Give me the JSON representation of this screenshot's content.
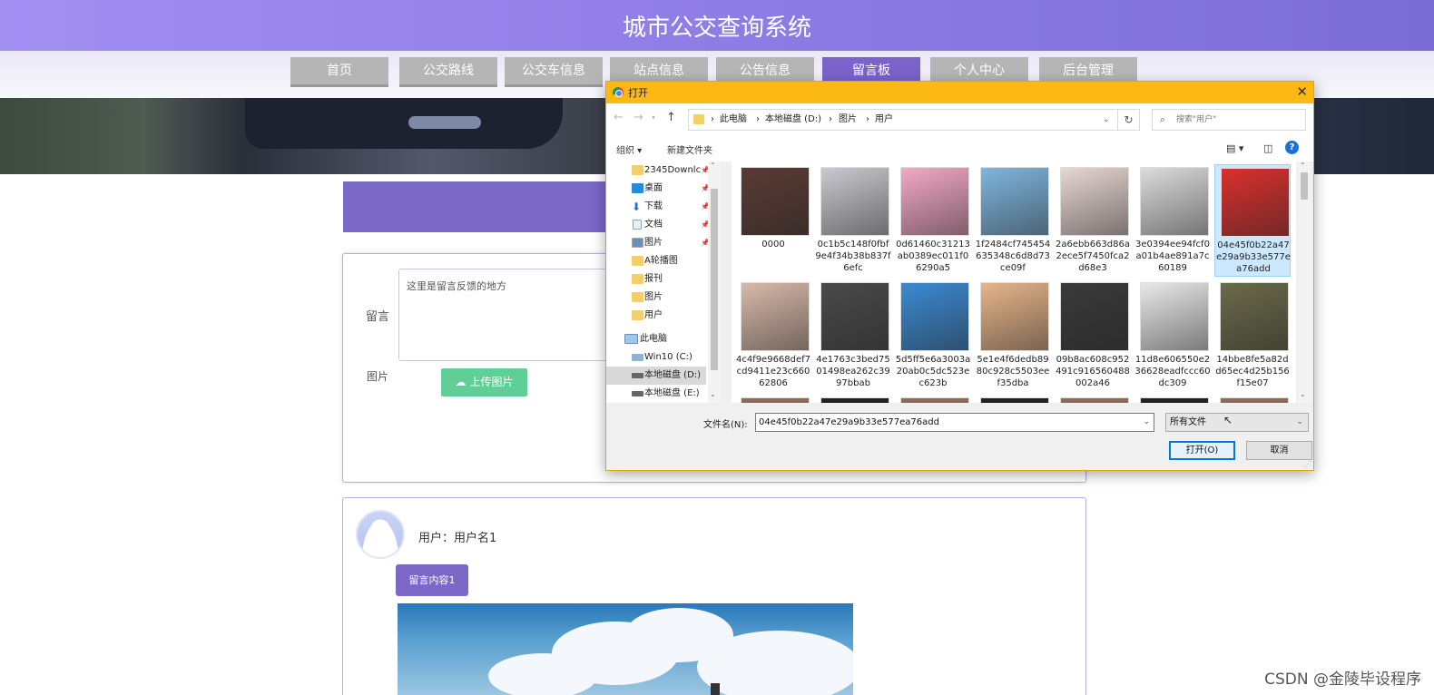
{
  "site": {
    "title": "城市公交查询系统",
    "nav": [
      "首页",
      "公交路线",
      "公交车信息",
      "站点信息",
      "公告信息",
      "留言板",
      "个人中心",
      "后台管理"
    ],
    "active_nav": "留言板"
  },
  "form": {
    "message_label": "留言",
    "message_placeholder": "这里是留言反馈的地方",
    "image_label": "图片",
    "upload_button": "上传图片"
  },
  "comment": {
    "user_line": "用户：用户名1",
    "content": "留言内容1"
  },
  "watermark": "CSDN @金陵毕设程序",
  "dialog": {
    "title": "打开",
    "breadcrumb": [
      "此电脑",
      "本地磁盘 (D:)",
      "图片",
      "用户"
    ],
    "search_placeholder": "搜索\"用户\"",
    "organize": "组织 ▾",
    "new_folder": "新建文件夹",
    "sidebar": [
      {
        "label": "2345Downlc",
        "icon": "folder-icon",
        "pinned": true
      },
      {
        "label": "桌面",
        "icon": "desktop-icon",
        "pinned": true
      },
      {
        "label": "下载",
        "icon": "download-icon",
        "pinned": true
      },
      {
        "label": "文档",
        "icon": "document-icon",
        "pinned": true
      },
      {
        "label": "图片",
        "icon": "pictures-icon",
        "pinned": true
      },
      {
        "label": "A轮播图",
        "icon": "folder-icon",
        "pinned": false
      },
      {
        "label": "报刊",
        "icon": "folder-icon",
        "pinned": false
      },
      {
        "label": "图片",
        "icon": "folder-icon",
        "pinned": false
      },
      {
        "label": "用户",
        "icon": "folder-icon",
        "pinned": false
      },
      {
        "label": "此电脑",
        "icon": "computer-icon",
        "pinned": false
      },
      {
        "label": "Win10 (C:)",
        "icon": "drive-icon",
        "pinned": false
      },
      {
        "label": "本地磁盘 (D:)",
        "icon": "drive-icon",
        "pinned": false,
        "selected": true
      },
      {
        "label": "本地磁盘 (E:)",
        "icon": "drive-icon",
        "pinned": false
      }
    ],
    "files": [
      {
        "name": "0000",
        "color": "#5a3b34"
      },
      {
        "name": "0c1b5c148f0fbf9e4f34b38b837f6efc",
        "color": "#c9c9cf"
      },
      {
        "name": "0d61460c31213ab0389ec011f06290a5",
        "color": "#f3a9c4"
      },
      {
        "name": "1f2484cf745454635348c6d8d73ce09f",
        "color": "#7fb6df"
      },
      {
        "name": "2a6ebb663d86a2ece5f7450fca2d68e3",
        "color": "#e8d7d2"
      },
      {
        "name": "3e0394ee94fcf0a01b4ae891a7c60189",
        "color": "#dcdcdc"
      },
      {
        "name": "04e45f0b22a47e29a9b33e577ea76add",
        "color": "#d9302d",
        "selected": true
      },
      {
        "name": "4c4f9e9668def7cd9411e23c66062806",
        "color": "#d8b9a9"
      },
      {
        "name": "4e1763c3bed7501498ea262c3997bbab",
        "color": "#4a4a4a"
      },
      {
        "name": "5d5ff5e6a3003a20ab0c5dc523ec623b",
        "color": "#3b8ad2"
      },
      {
        "name": "5e1e4f6dedb8980c928c5503eef35dba",
        "color": "#e7b58a"
      },
      {
        "name": "09b8ac608c952491c916560488002a46",
        "color": "#3a3a3a"
      },
      {
        "name": "11d8e606550e236628eadfccc60dc309",
        "color": "#e9e9e9"
      },
      {
        "name": "14bbe8fe5a82dd65ec4d25b156f15e07",
        "color": "#6b6a4a"
      }
    ],
    "filename_label": "文件名(N):",
    "filename_value": "04e45f0b22a47e29a9b33e577ea76add",
    "filetype": "所有文件",
    "open_button": "打开(O)",
    "cancel_button": "取消"
  }
}
